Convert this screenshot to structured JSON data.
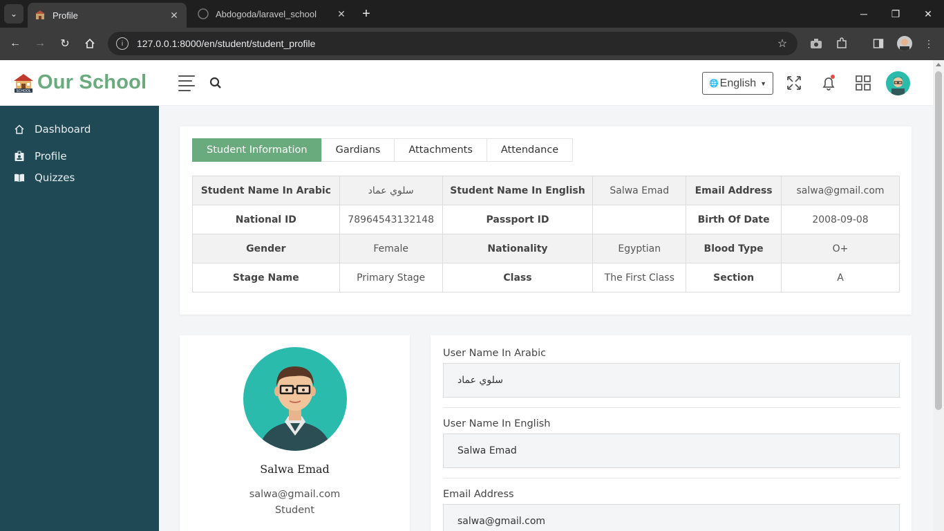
{
  "browser": {
    "tabs": [
      {
        "title": "Profile",
        "active": true
      },
      {
        "title": "Abdogoda/laravel_school",
        "active": false
      }
    ],
    "url": "127.0.0.1:8000/en/student/student_profile"
  },
  "header": {
    "logo_text": "Our School",
    "logo_badge": "SCHOOL",
    "language": "English"
  },
  "sidebar": {
    "items": [
      {
        "label": "Dashboard",
        "icon": "home-icon"
      },
      {
        "label": "Profile",
        "icon": "id-badge-icon"
      },
      {
        "label": "Quizzes",
        "icon": "book-icon"
      }
    ]
  },
  "info_tabs": [
    "Student Information",
    "Gardians",
    "Attachments",
    "Attendance"
  ],
  "info_table": {
    "rows": [
      [
        "Student Name In Arabic",
        "سلوي عماد",
        "Student Name In English",
        "Salwa Emad",
        "Email Address",
        "salwa@gmail.com"
      ],
      [
        "National ID",
        "78964543132148",
        "Passport ID",
        "",
        "Birth Of Date",
        "2008-09-08"
      ],
      [
        "Gender",
        "Female",
        "Nationality",
        "Egyptian",
        "Blood Type",
        "O+"
      ],
      [
        "Stage Name",
        "Primary Stage",
        "Class",
        "The First Class",
        "Section",
        "A"
      ]
    ]
  },
  "profile_card": {
    "name": "Salwa Emad",
    "email": "salwa@gmail.com",
    "role": "Student"
  },
  "form": {
    "fields": [
      {
        "label": "User Name In Arabic",
        "value": "سلوي عماد"
      },
      {
        "label": "User Name In English",
        "value": "Salwa Emad"
      },
      {
        "label": "Email Address",
        "value": "salwa@gmail.com"
      }
    ]
  },
  "colors": {
    "accent": "#6aab7e",
    "sidebar": "#1f4954",
    "avatar_bg": "#2bbbad"
  }
}
